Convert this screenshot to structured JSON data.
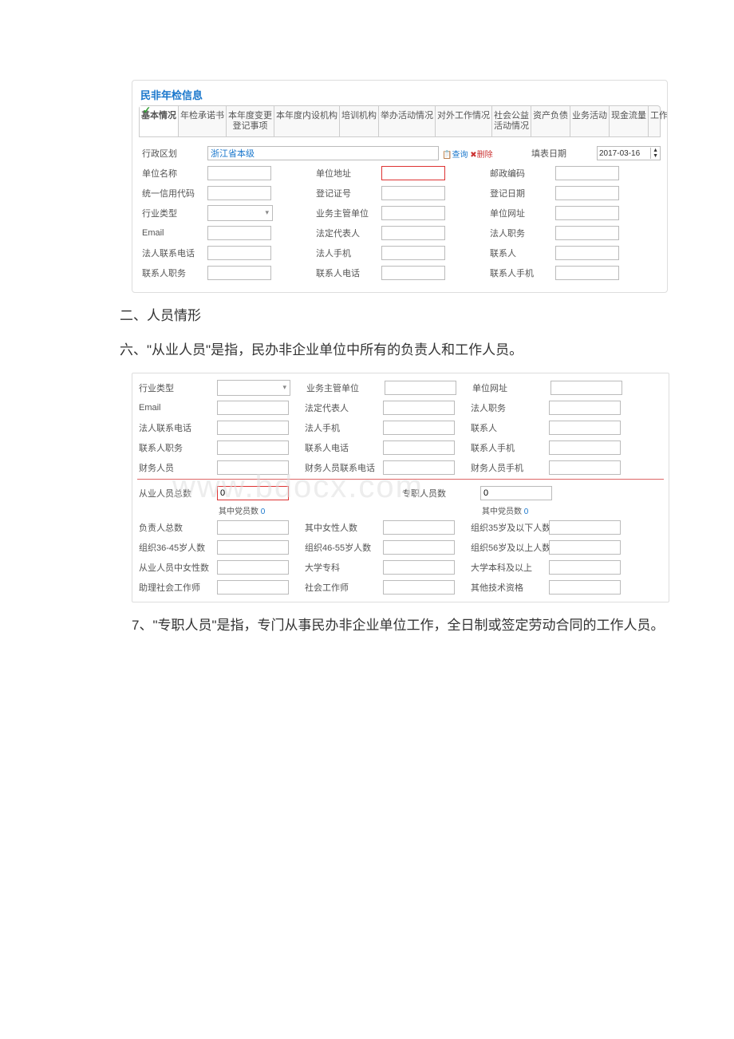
{
  "panel1": {
    "title": "民非年检信息",
    "tabs": [
      "基本情况",
      "年检承诺书",
      "本年度变更\n登记事项",
      "本年度内设机构",
      "培训机构",
      "举办活动情况",
      "对外工作情况",
      "社会公益\n活动情况",
      "资产负债",
      "业务活动",
      "现金流量",
      "工作总结"
    ],
    "activeTab": 0,
    "rows": [
      {
        "c": [
          {
            "l": "行政区划",
            "v": "浙江省本级",
            "link": true,
            "big": true,
            "query": true
          },
          {
            "l": "填表日期",
            "date": "2017-03-16"
          }
        ]
      },
      {
        "c": [
          {
            "l": "单位名称"
          },
          {
            "l": "单位地址",
            "red": true
          },
          {
            "l": "邮政编码"
          }
        ]
      },
      {
        "c": [
          {
            "l": "统一信用代码"
          },
          {
            "l": "登记证号"
          },
          {
            "l": "登记日期"
          }
        ]
      },
      {
        "c": [
          {
            "l": "行业类型",
            "sel": true
          },
          {
            "l": "业务主管单位"
          },
          {
            "l": "单位网址"
          }
        ]
      },
      {
        "c": [
          {
            "l": "Email"
          },
          {
            "l": "法定代表人"
          },
          {
            "l": "法人职务"
          }
        ]
      },
      {
        "c": [
          {
            "l": "法人联系电话"
          },
          {
            "l": "法人手机"
          },
          {
            "l": "联系人"
          }
        ]
      },
      {
        "c": [
          {
            "l": "联系人职务"
          },
          {
            "l": "联系人电话"
          },
          {
            "l": "联系人手机"
          }
        ]
      }
    ]
  },
  "text1": "二、人员情形",
  "text2": "六、\"从业人员\"是指，民办非企业单位中所有的负责人和工作人员。",
  "panel2": {
    "watermark": "www.bdocx.com",
    "rows": [
      {
        "c": [
          {
            "l": "行业类型",
            "sel": true
          },
          {
            "l": "业务主管单位"
          },
          {
            "l": "单位网址"
          }
        ]
      },
      {
        "c": [
          {
            "l": "Email"
          },
          {
            "l": "法定代表人"
          },
          {
            "l": "法人职务"
          }
        ]
      },
      {
        "c": [
          {
            "l": "法人联系电话"
          },
          {
            "l": "法人手机"
          },
          {
            "l": "联系人"
          }
        ]
      },
      {
        "c": [
          {
            "l": "联系人职务"
          },
          {
            "l": "联系人电话"
          },
          {
            "l": "联系人手机"
          }
        ]
      },
      {
        "c": [
          {
            "l": "财务人员"
          },
          {
            "l": "财务人员联系电话"
          },
          {
            "l": "财务人员手机"
          }
        ]
      }
    ],
    "special": {
      "left": {
        "l": "从业人员总数",
        "red": true,
        "v": "0",
        "sub": "其中党员数",
        "sv": "0"
      },
      "right": {
        "l": "专职人员数",
        "v": "0",
        "sub": "其中党员数",
        "sv": "0"
      }
    },
    "rows2": [
      {
        "c": [
          {
            "l": "负责人总数"
          },
          {
            "l": "其中女性人数"
          },
          {
            "l": "组织35岁及以下人数"
          }
        ]
      },
      {
        "c": [
          {
            "l": "组织36-45岁人数"
          },
          {
            "l": "组织46-55岁人数"
          },
          {
            "l": "组织56岁及以上人数"
          }
        ]
      },
      {
        "c": [
          {
            "l": "从业人员中女性数"
          },
          {
            "l": "大学专科"
          },
          {
            "l": "大学本科及以上"
          }
        ]
      },
      {
        "c": [
          {
            "l": "助理社会工作师"
          },
          {
            "l": "社会工作师"
          },
          {
            "l": "其他技术资格"
          }
        ]
      }
    ]
  },
  "text3": "7、\"专职人员\"是指，专门从事民办非企业单位工作，全日制或签定劳动合同的工作人员。",
  "icons": {
    "query": "查询",
    "delete": "删除"
  }
}
